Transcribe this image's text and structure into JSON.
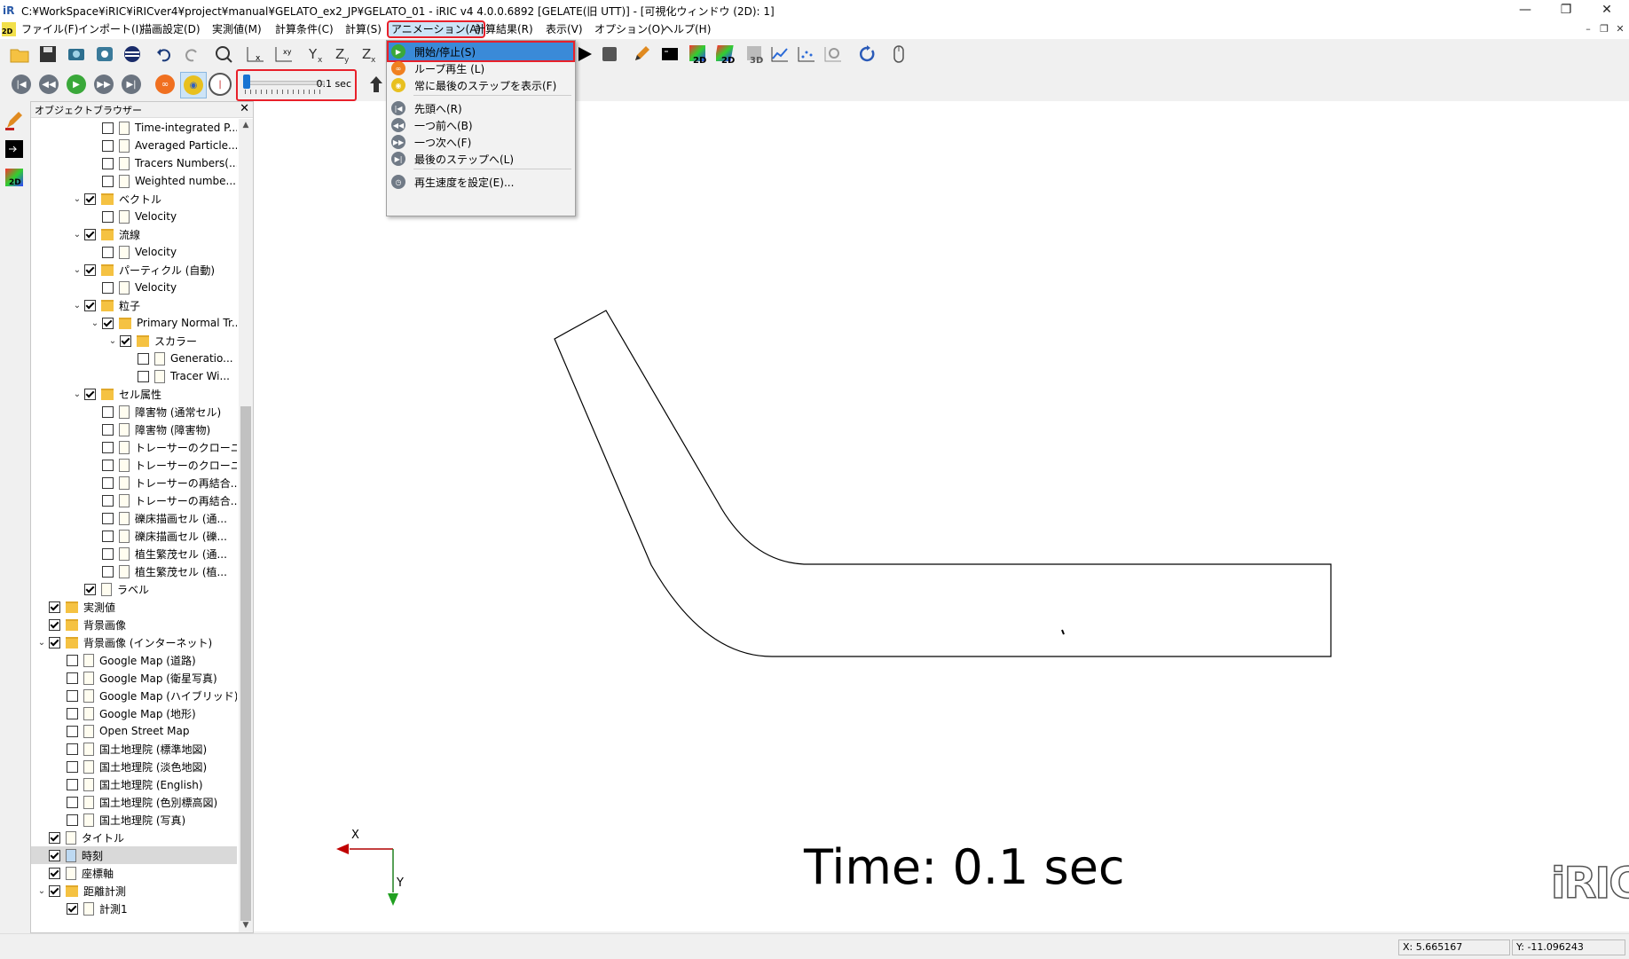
{
  "window": {
    "title": "C:¥WorkSpace¥iRIC¥iRICver4¥project¥manual¥GELATO_ex2_JP¥GELATO_01 - iRIC v4 4.0.0.6892 [GELATE(旧 UTT)] - [可視化ウィンドウ (2D): 1]",
    "minimize": "—",
    "restore": "❐",
    "close": "✕"
  },
  "menubar": {
    "items": [
      "ファイル(F)",
      "インポート(I)",
      "描画設定(D)",
      "実測値(M)",
      "計算条件(C)",
      "計算(S)",
      "アニメーション(A)",
      "計算結果(R)",
      "表示(V)",
      "オプション(O)",
      "ヘルプ(H)"
    ],
    "mdi_icon": "2D"
  },
  "slider": {
    "value_label": "0.1 sec",
    "position": 0.0
  },
  "panel": {
    "title": "オブジェクトブラウザー",
    "close": "✕",
    "rows": [
      {
        "label": "Time-integrated P...",
        "indent": 4,
        "checked": false,
        "icon": "file",
        "exp": ""
      },
      {
        "label": "Averaged Particle...",
        "indent": 4,
        "checked": false,
        "icon": "file",
        "exp": ""
      },
      {
        "label": "Tracers Numbers(...",
        "indent": 4,
        "checked": false,
        "icon": "file",
        "exp": ""
      },
      {
        "label": "Weighted numbe...",
        "indent": 4,
        "checked": false,
        "icon": "file",
        "exp": ""
      },
      {
        "label": "ベクトル",
        "indent": 3,
        "checked": true,
        "icon": "folder",
        "exp": "v"
      },
      {
        "label": "Velocity",
        "indent": 4,
        "checked": false,
        "icon": "file",
        "exp": ""
      },
      {
        "label": "流線",
        "indent": 3,
        "checked": true,
        "icon": "folder",
        "exp": "v"
      },
      {
        "label": "Velocity",
        "indent": 4,
        "checked": false,
        "icon": "file",
        "exp": ""
      },
      {
        "label": "パーティクル (自動)",
        "indent": 3,
        "checked": true,
        "icon": "folder",
        "exp": "v"
      },
      {
        "label": "Velocity",
        "indent": 4,
        "checked": false,
        "icon": "file",
        "exp": ""
      },
      {
        "label": "粒子",
        "indent": 3,
        "checked": true,
        "icon": "folder",
        "exp": "v"
      },
      {
        "label": "Primary Normal Tr...",
        "indent": 4,
        "checked": true,
        "icon": "folder",
        "exp": "v"
      },
      {
        "label": "スカラー",
        "indent": 5,
        "checked": true,
        "icon": "folder",
        "exp": "v"
      },
      {
        "label": "Generatio...",
        "indent": 6,
        "checked": false,
        "icon": "file",
        "exp": ""
      },
      {
        "label": "Tracer Wi...",
        "indent": 6,
        "checked": false,
        "icon": "file",
        "exp": ""
      },
      {
        "label": "セル属性",
        "indent": 3,
        "checked": true,
        "icon": "folder",
        "exp": "v"
      },
      {
        "label": "障害物 (通常セル)",
        "indent": 4,
        "checked": false,
        "icon": "file",
        "exp": ""
      },
      {
        "label": "障害物 (障害物)",
        "indent": 4,
        "checked": false,
        "icon": "file",
        "exp": ""
      },
      {
        "label": "トレーサーのクローニ...",
        "indent": 4,
        "checked": false,
        "icon": "file",
        "exp": ""
      },
      {
        "label": "トレーサーのクローニ...",
        "indent": 4,
        "checked": false,
        "icon": "file",
        "exp": ""
      },
      {
        "label": "トレーサーの再結合...",
        "indent": 4,
        "checked": false,
        "icon": "file",
        "exp": ""
      },
      {
        "label": "トレーサーの再結合...",
        "indent": 4,
        "checked": false,
        "icon": "file",
        "exp": ""
      },
      {
        "label": "礫床描画セル (通...",
        "indent": 4,
        "checked": false,
        "icon": "file",
        "exp": ""
      },
      {
        "label": "礫床描画セル (礫...",
        "indent": 4,
        "checked": false,
        "icon": "file",
        "exp": ""
      },
      {
        "label": "植生繁茂セル (通...",
        "indent": 4,
        "checked": false,
        "icon": "file",
        "exp": ""
      },
      {
        "label": "植生繁茂セル (植...",
        "indent": 4,
        "checked": false,
        "icon": "file",
        "exp": ""
      },
      {
        "label": "ラベル",
        "indent": 3,
        "checked": true,
        "icon": "file",
        "exp": ""
      },
      {
        "label": "実測値",
        "indent": 1,
        "checked": true,
        "icon": "folder",
        "exp": ""
      },
      {
        "label": "背景画像",
        "indent": 1,
        "checked": true,
        "icon": "folder",
        "exp": ""
      },
      {
        "label": "背景画像 (インターネット)",
        "indent": 1,
        "checked": true,
        "icon": "folder",
        "exp": "v"
      },
      {
        "label": "Google Map (道路)",
        "indent": 2,
        "checked": false,
        "icon": "file",
        "exp": ""
      },
      {
        "label": "Google Map (衛星写真)",
        "indent": 2,
        "checked": false,
        "icon": "file",
        "exp": ""
      },
      {
        "label": "Google Map (ハイブリッド)",
        "indent": 2,
        "checked": false,
        "icon": "file",
        "exp": ""
      },
      {
        "label": "Google Map (地形)",
        "indent": 2,
        "checked": false,
        "icon": "file",
        "exp": ""
      },
      {
        "label": "Open Street Map",
        "indent": 2,
        "checked": false,
        "icon": "file",
        "exp": ""
      },
      {
        "label": "国土地理院 (標準地図)",
        "indent": 2,
        "checked": false,
        "icon": "file",
        "exp": ""
      },
      {
        "label": "国土地理院 (淡色地図)",
        "indent": 2,
        "checked": false,
        "icon": "file",
        "exp": ""
      },
      {
        "label": "国土地理院 (English)",
        "indent": 2,
        "checked": false,
        "icon": "file",
        "exp": ""
      },
      {
        "label": "国土地理院 (色別標高図)",
        "indent": 2,
        "checked": false,
        "icon": "file",
        "exp": ""
      },
      {
        "label": "国土地理院 (写真)",
        "indent": 2,
        "checked": false,
        "icon": "file",
        "exp": ""
      },
      {
        "label": "タイトル",
        "indent": 1,
        "checked": true,
        "icon": "file",
        "exp": ""
      },
      {
        "label": "時刻",
        "indent": 1,
        "checked": true,
        "icon": "file-blue",
        "exp": "",
        "selected": true
      },
      {
        "label": "座標軸",
        "indent": 1,
        "checked": true,
        "icon": "file",
        "exp": ""
      },
      {
        "label": "距離計測",
        "indent": 1,
        "checked": true,
        "icon": "folder",
        "exp": "v"
      },
      {
        "label": "計測1",
        "indent": 2,
        "checked": true,
        "icon": "file",
        "exp": ""
      }
    ]
  },
  "dropdown": {
    "items": [
      {
        "label": "開始/停止(S)",
        "icon": "play",
        "color": "#3aa83a",
        "highlight": true
      },
      {
        "label": "ループ再生 (L)",
        "icon": "loop",
        "color": "#f08020"
      },
      {
        "label": "常に最後のステップを表示(F)",
        "icon": "eye",
        "color": "#e8c020"
      },
      {
        "label": "先頭へ(R)",
        "icon": "first",
        "color": "#707a86"
      },
      {
        "label": "一つ前へ(B)",
        "icon": "prev",
        "color": "#707a86"
      },
      {
        "label": "一つ次へ(F)",
        "icon": "next",
        "color": "#707a86"
      },
      {
        "label": "最後のステップへ(L)",
        "icon": "last",
        "color": "#707a86"
      },
      {
        "label": "再生速度を設定(E)...",
        "icon": "clock",
        "color": "#707a86"
      }
    ]
  },
  "canvas": {
    "time_label": "Time: 0.1 sec",
    "axis_x": "X",
    "axis_y": "Y",
    "logo": "iRIC"
  },
  "status": {
    "x": "X: 5.665167",
    "y": "Y: -11.096243"
  }
}
